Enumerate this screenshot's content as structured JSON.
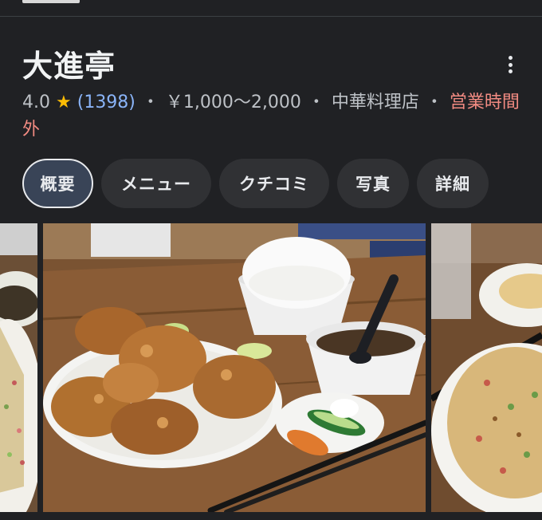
{
  "place": {
    "name": "大進亭",
    "rating": "4.0",
    "star": "★",
    "review_count": "(1398)",
    "separator": "・",
    "price": "￥1,000～2,000",
    "category": "中華料理店",
    "status": "営業時間外"
  },
  "tabs": [
    {
      "label": "概要",
      "active": true
    },
    {
      "label": "メニュー",
      "active": false
    },
    {
      "label": "クチコミ",
      "active": false
    },
    {
      "label": "写真",
      "active": false
    },
    {
      "label": "詳細",
      "active": false
    }
  ],
  "icons": {
    "more": "more-vert-icon",
    "rating_star": "star-icon"
  },
  "colors": {
    "background": "#202124",
    "star": "#fbbc04",
    "review_link": "#8ab4f8",
    "closed_status": "#f28b82",
    "active_tab_bg": "#394457",
    "tab_bg": "#303134"
  }
}
